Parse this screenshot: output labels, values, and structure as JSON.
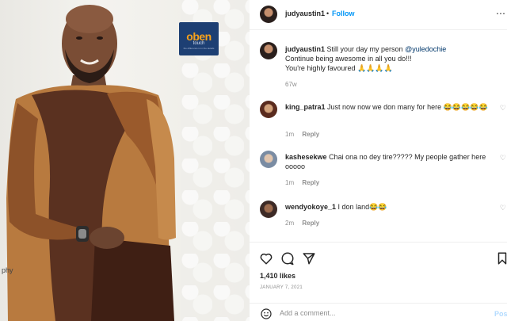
{
  "post": {
    "username": "judyaustin1",
    "separator": "•",
    "follow_label": "Follow",
    "more_icon": "ellipsis-icon"
  },
  "photo": {
    "logo_main": "oben",
    "logo_sub": "touch",
    "logo_tiny": "the difference is in the details",
    "cut_text": "phy"
  },
  "caption": {
    "username": "judyaustin1",
    "line1": "Still your day my person ",
    "mention": "@yuledochie",
    "line2": "Continue being awesome in all you do!!!",
    "line3": "You're highly favoured 🙏🙏🙏🙏",
    "age": "67w"
  },
  "comments": [
    {
      "username": "king_patra1",
      "text": "Just now now we don many for here 😂😂😂😂😂",
      "age": "1m",
      "reply": "Reply"
    },
    {
      "username": "kashesekwe",
      "text": "Chai ona no dey tire????? My people gather here ooooo",
      "age": "1m",
      "reply": "Reply"
    },
    {
      "username": "wendyokoye_1",
      "text": "I don land😂😂",
      "age": "2m",
      "reply": "Reply"
    }
  ],
  "stats": {
    "likes": "1,410 likes",
    "date": "JANUARY 7, 2021"
  },
  "composer": {
    "placeholder": "Add a comment...",
    "post_label": "Pos"
  },
  "colors": {
    "link_blue": "#0095f6",
    "mention": "#00376b",
    "muted": "#8e8e8e",
    "post_disabled": "#b3dbff"
  }
}
